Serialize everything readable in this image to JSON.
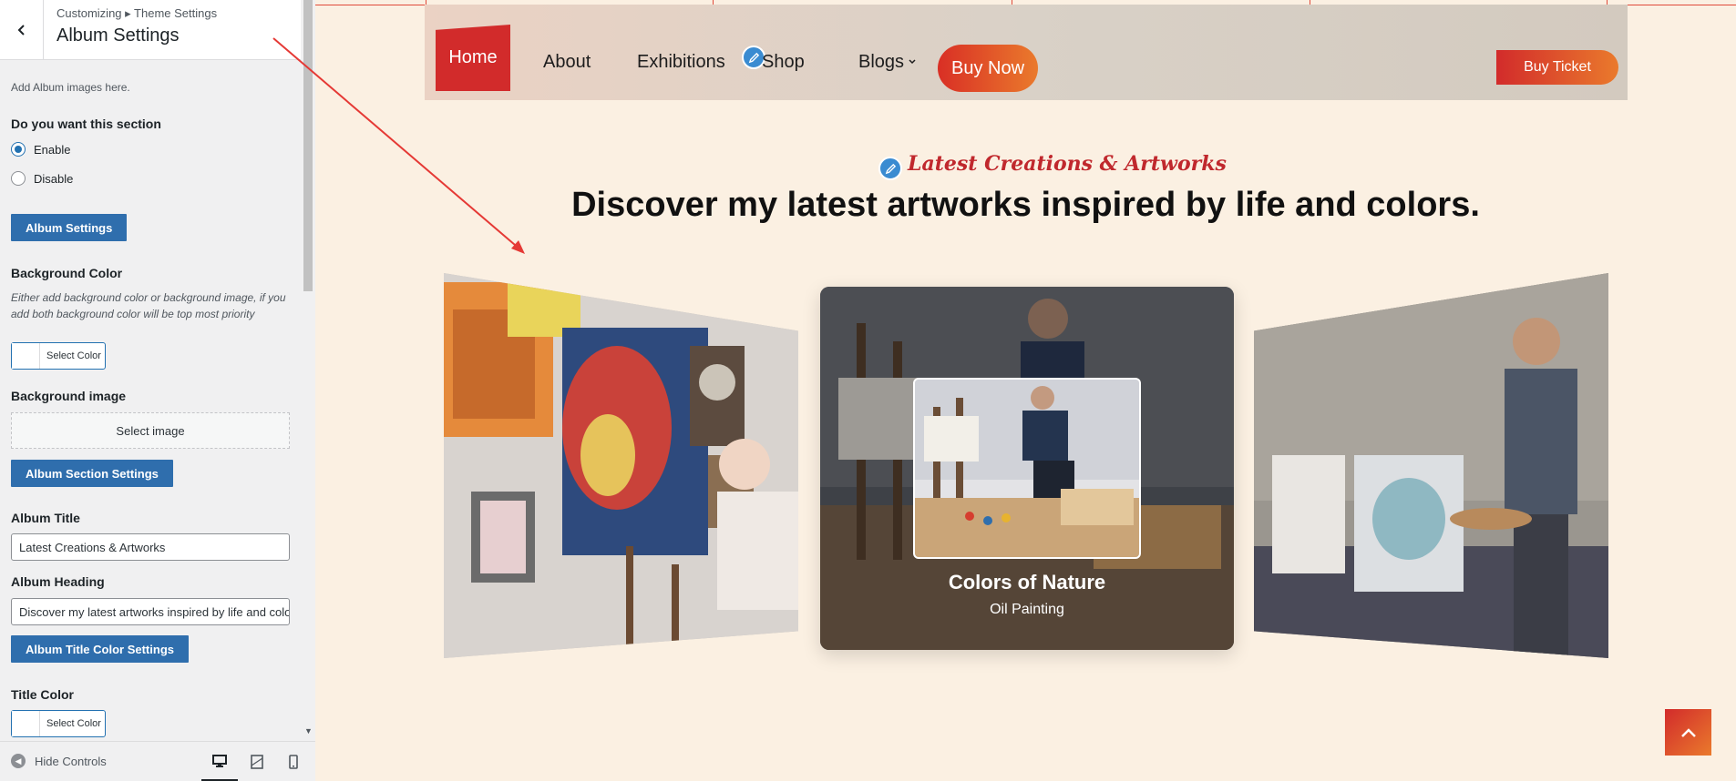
{
  "customizer": {
    "breadcrumb": "Customizing ▸ Theme Settings",
    "title": "Album Settings",
    "description": "Add Album images here.",
    "section_toggle_label": "Do you want this section",
    "radio_enable": "Enable",
    "radio_disable": "Disable",
    "album_settings_button": "Album Settings",
    "bg_color_label": "Background Color",
    "bg_color_help": "Either add background color or background image, if you add both background color will be top most priority",
    "select_color": "Select Color",
    "bg_image_label": "Background image",
    "select_image": "Select image",
    "album_section_settings_button": "Album Section Settings",
    "album_title_label": "Album Title",
    "album_title_value": "Latest Creations & Artworks",
    "album_heading_label": "Album Heading",
    "album_heading_value": "Discover my latest artworks inspired by life and colors.",
    "album_title_color_button": "Album Title Color Settings",
    "title_color_label": "Title Color",
    "hide_controls": "Hide Controls"
  },
  "nav": {
    "home": "Home",
    "about": "About",
    "exhibitions": "Exhibitions",
    "shop": "Shop",
    "blogs": "Blogs",
    "buy_now": "Buy Now",
    "buy_ticket": "Buy Ticket"
  },
  "album": {
    "subtitle": "Latest Creations & Artworks",
    "heading": "Discover my latest artworks inspired by life and colors.",
    "center_card_title": "Colors of Nature",
    "center_card_subtitle": "Oil Painting"
  },
  "icons": {
    "back": "chevron-left-icon",
    "edit": "pencil-icon",
    "dropdown": "chevron-down-icon",
    "scroll_top": "chevron-up-icon",
    "hide_controls": "arrow-circle-left-icon",
    "desktop": "desktop-icon",
    "tablet": "tablet-icon",
    "mobile": "mobile-icon"
  },
  "colors": {
    "accent_red": "#d22b2b",
    "accent_orange": "#ea7a2c",
    "wp_blue": "#2f6ead",
    "page_bg": "#fbf0e2",
    "subtitle_red": "#c0282d"
  }
}
